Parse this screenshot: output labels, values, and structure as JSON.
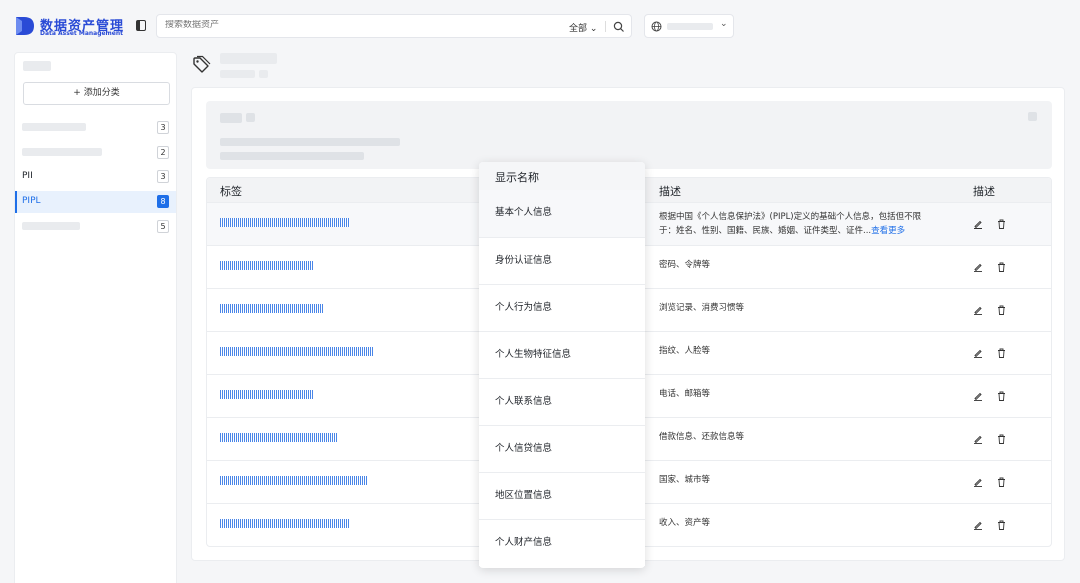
{
  "app": {
    "title_cn": "数据资产管理",
    "title_en": "Data Asset Management"
  },
  "search": {
    "placeholder": "搜索数据资产",
    "scope": "全部"
  },
  "sidebar": {
    "add_label": "+ 添加分类",
    "categories": [
      {
        "label": "",
        "count": "3"
      },
      {
        "label": "",
        "count": "2"
      },
      {
        "label": "PII",
        "count": "3"
      },
      {
        "label": "PIPL",
        "count": "8"
      },
      {
        "label": "",
        "count": "5"
      }
    ]
  },
  "table": {
    "headers": {
      "tag": "标签",
      "desc": "描述",
      "actions": "描述"
    },
    "rows": [
      {
        "desc_line1": "根据中国《个人信息保护法》(PIPL)定义的基础个人信息，包括但不限",
        "desc_line2": "于：姓名、性别、国籍、民族、婚姻、证件类型、证件...",
        "more": "查看更多"
      },
      {
        "desc_line1": "密码、令牌等"
      },
      {
        "desc_line1": "浏览记录、消费习惯等"
      },
      {
        "desc_line1": "指纹、人脸等"
      },
      {
        "desc_line1": "电话、邮箱等"
      },
      {
        "desc_line1": "借款信息、还款信息等"
      },
      {
        "desc_line1": "国家、城市等"
      },
      {
        "desc_line1": "收入、资产等"
      }
    ]
  },
  "popup": {
    "title": "显示名称",
    "options": [
      "基本个人信息",
      "身份认证信息",
      "个人行为信息",
      "个人生物特征信息",
      "个人联系信息",
      "个人信贷信息",
      "地区位置信息",
      "个人财产信息"
    ]
  }
}
